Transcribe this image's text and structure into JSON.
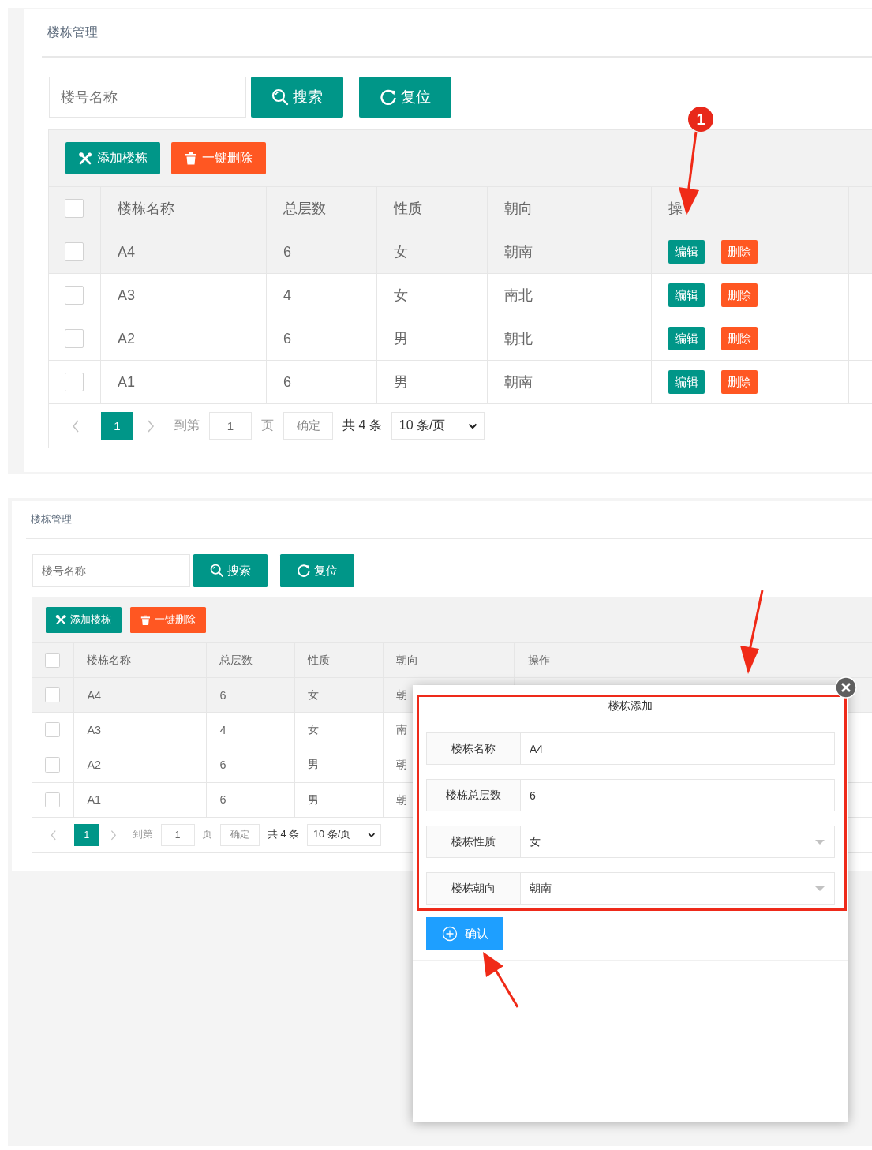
{
  "screens": [
    {
      "title": "楼栋管理",
      "search": {
        "placeholder": "楼号名称"
      },
      "search_button": "搜索",
      "reset_button": "复位",
      "toolbar": [
        {
          "kind": "add",
          "label": "添加楼栋"
        },
        {
          "kind": "delete",
          "label": "一键删除"
        }
      ],
      "columns": [
        "楼栋名称",
        "总层数",
        "性质",
        "朝向",
        "操"
      ],
      "header_checked": false,
      "rows": [
        {
          "checked": false,
          "highlighted": true,
          "cells": [
            "A4",
            "6",
            "女",
            "朝南"
          ],
          "actions": [
            {
              "kind": "edit",
              "label": "编辑"
            },
            {
              "kind": "delete",
              "label": "删除"
            }
          ]
        },
        {
          "checked": false,
          "highlighted": false,
          "cells": [
            "A3",
            "4",
            "女",
            "南北"
          ],
          "actions": [
            {
              "kind": "edit",
              "label": "编辑"
            },
            {
              "kind": "delete",
              "label": "删除"
            }
          ]
        },
        {
          "checked": false,
          "highlighted": false,
          "cells": [
            "A2",
            "6",
            "男",
            "朝北"
          ],
          "actions": [
            {
              "kind": "edit",
              "label": "编辑"
            },
            {
              "kind": "delete",
              "label": "删除"
            }
          ]
        },
        {
          "checked": false,
          "highlighted": false,
          "cells": [
            "A1",
            "6",
            "男",
            "朝南"
          ],
          "actions": [
            {
              "kind": "edit",
              "label": "编辑"
            },
            {
              "kind": "delete",
              "label": "删除"
            }
          ]
        }
      ],
      "pagination": {
        "current": "1",
        "goto_label": "到第",
        "goto_value": "1",
        "page_label": "页",
        "confirm": "确定",
        "total": "共 4 条",
        "page_size": "10 条/页"
      },
      "badge": "1"
    },
    {
      "title": "楼栋管理",
      "search": {
        "placeholder": "楼号名称"
      },
      "search_button": "搜索",
      "reset_button": "复位",
      "toolbar": [
        {
          "kind": "add",
          "label": "添加楼栋"
        },
        {
          "kind": "delete",
          "label": "一键删除"
        }
      ],
      "columns": [
        "楼栋名称",
        "总层数",
        "性质",
        "朝向",
        "操作"
      ],
      "header_checked": false,
      "rows": [
        {
          "checked": false,
          "highlighted": true,
          "cells": [
            "A4",
            "6",
            "女",
            "朝"
          ]
        },
        {
          "checked": false,
          "highlighted": false,
          "cells": [
            "A3",
            "4",
            "女",
            "南"
          ]
        },
        {
          "checked": false,
          "highlighted": false,
          "cells": [
            "A2",
            "6",
            "男",
            "朝"
          ]
        },
        {
          "checked": false,
          "highlighted": false,
          "cells": [
            "A1",
            "6",
            "男",
            "朝"
          ]
        }
      ],
      "pagination": {
        "current": "1",
        "goto_label": "到第",
        "goto_value": "1",
        "page_label": "页",
        "confirm": "确定",
        "total": "共 4 条",
        "page_size": "10 条/页"
      },
      "modal": {
        "title": "楼栋添加",
        "fields": [
          {
            "kind": "text",
            "label": "楼栋名称",
            "value": "A4"
          },
          {
            "kind": "text",
            "label": "楼栋总层数",
            "value": "6"
          },
          {
            "kind": "select",
            "label": "楼栋性质",
            "value": "女"
          },
          {
            "kind": "select",
            "label": "楼栋朝向",
            "value": "朝南"
          }
        ],
        "submit": "确认"
      }
    }
  ]
}
